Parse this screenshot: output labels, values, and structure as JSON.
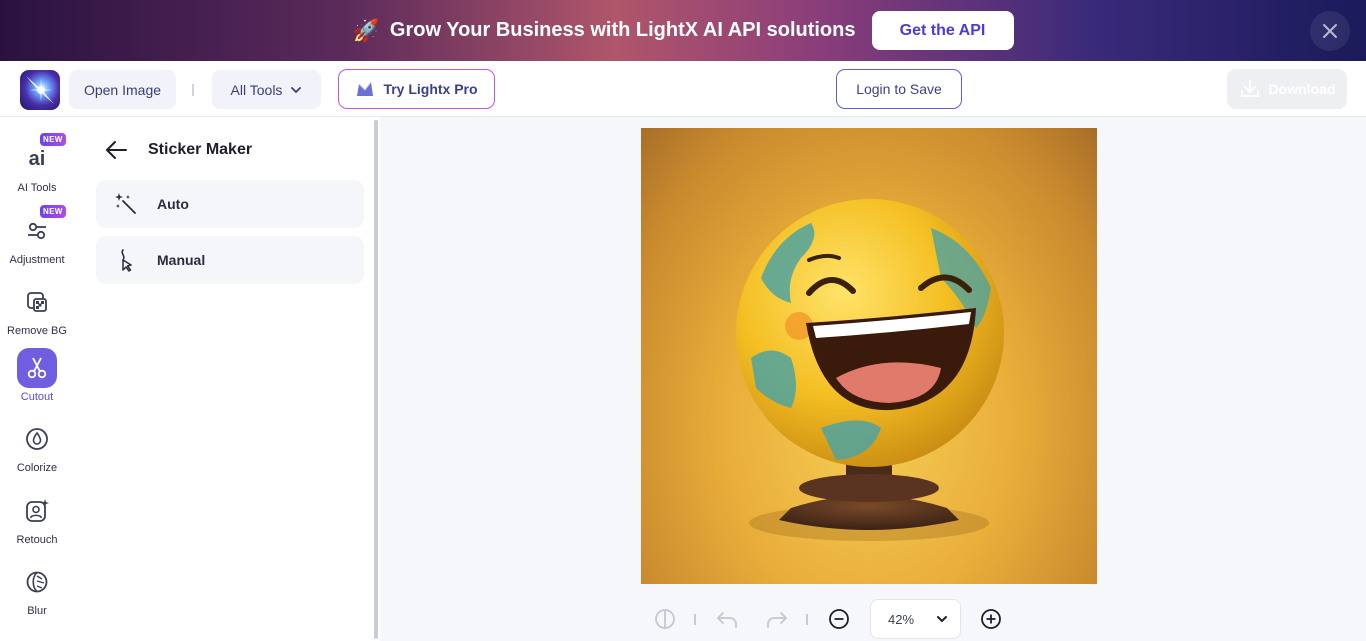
{
  "banner": {
    "text": "Grow Your Business with LightX AI API solutions",
    "cta_label": "Get the API"
  },
  "toolbar": {
    "open_image_label": "Open Image",
    "all_tools_label": "All Tools",
    "try_pro_label": "Try Lightx Pro",
    "login_label": "Login to Save",
    "download_label": "Download"
  },
  "rail": {
    "items": [
      {
        "label": "AI Tools",
        "badge": "NEW"
      },
      {
        "label": "Adjustment",
        "badge": "NEW"
      },
      {
        "label": "Remove BG"
      },
      {
        "label": "Cutout"
      },
      {
        "label": "Colorize"
      },
      {
        "label": "Retouch"
      },
      {
        "label": "Blur"
      }
    ]
  },
  "panel": {
    "title": "Sticker Maker",
    "options": [
      {
        "label": "Auto"
      },
      {
        "label": "Manual"
      }
    ]
  },
  "canvas": {
    "zoom": "42%"
  },
  "colors": {
    "accent": "#6f5fe0",
    "pro_border": "#c452e6",
    "login_border": "#5e5fd4"
  }
}
